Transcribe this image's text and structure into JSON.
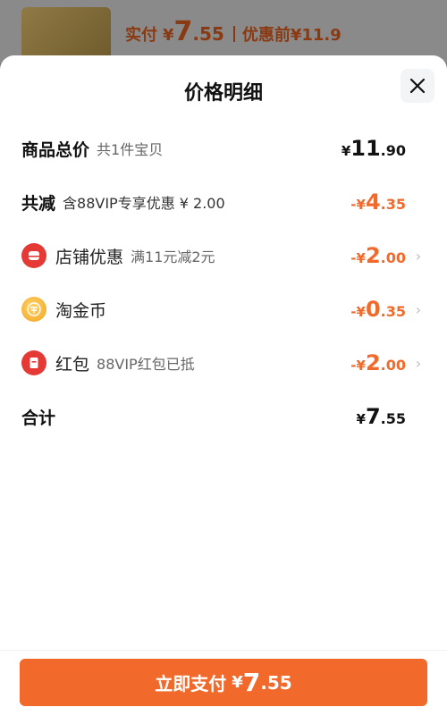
{
  "background": {
    "label": "实付",
    "yen": "¥",
    "price_int": "7",
    "price_dec": ".55",
    "before_label": "优惠前¥11.9"
  },
  "sheet": {
    "title": "价格明细",
    "rows": [
      {
        "label": "商品总价",
        "sub": "共1件宝贝",
        "yen": "¥",
        "int": "11",
        "dec": ".90",
        "color": "#111111"
      },
      {
        "label": "共减",
        "sub": "含88VIP专享优惠 ¥ 2.00",
        "yen": "-¥",
        "int": "4",
        "dec": ".35",
        "color": "#f26a2b"
      },
      {
        "label": "店铺优惠",
        "sub": "满11元减2元",
        "yen": "-¥",
        "int": "2",
        "dec": ".00",
        "color": "#f26a2b",
        "icon": "shop-icon"
      },
      {
        "label": "淘金币",
        "sub": "",
        "yen": "-¥",
        "int": "0",
        "dec": ".35",
        "color": "#f26a2b",
        "icon": "coin-icon"
      },
      {
        "label": "红包",
        "sub": "88VIP红包已抵",
        "yen": "-¥",
        "int": "2",
        "dec": ".00",
        "color": "#f26a2b",
        "icon": "red-envelope-icon"
      },
      {
        "label": "合计",
        "sub": "",
        "yen": "¥",
        "int": "7",
        "dec": ".55",
        "color": "#111111"
      }
    ],
    "chevron": "›"
  },
  "pay_button": {
    "label": "立即支付",
    "yen": "¥",
    "int": "7",
    "dec": ".55",
    "color": "#f26a2b"
  }
}
